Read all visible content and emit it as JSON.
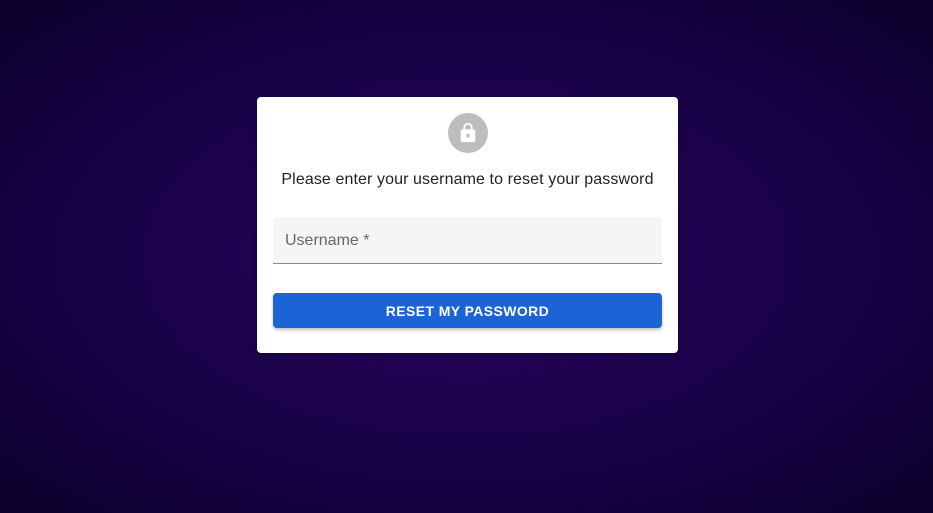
{
  "reset_card": {
    "avatar_icon": "lock-icon",
    "avatar_color": "#bdbdbd",
    "instruction": "Please enter your username to reset your password",
    "username_field": {
      "label": "Username *",
      "value": ""
    },
    "submit_label": "RESET MY PASSWORD",
    "accent_color": "#1c63d5"
  },
  "background_color": "#1f0350"
}
